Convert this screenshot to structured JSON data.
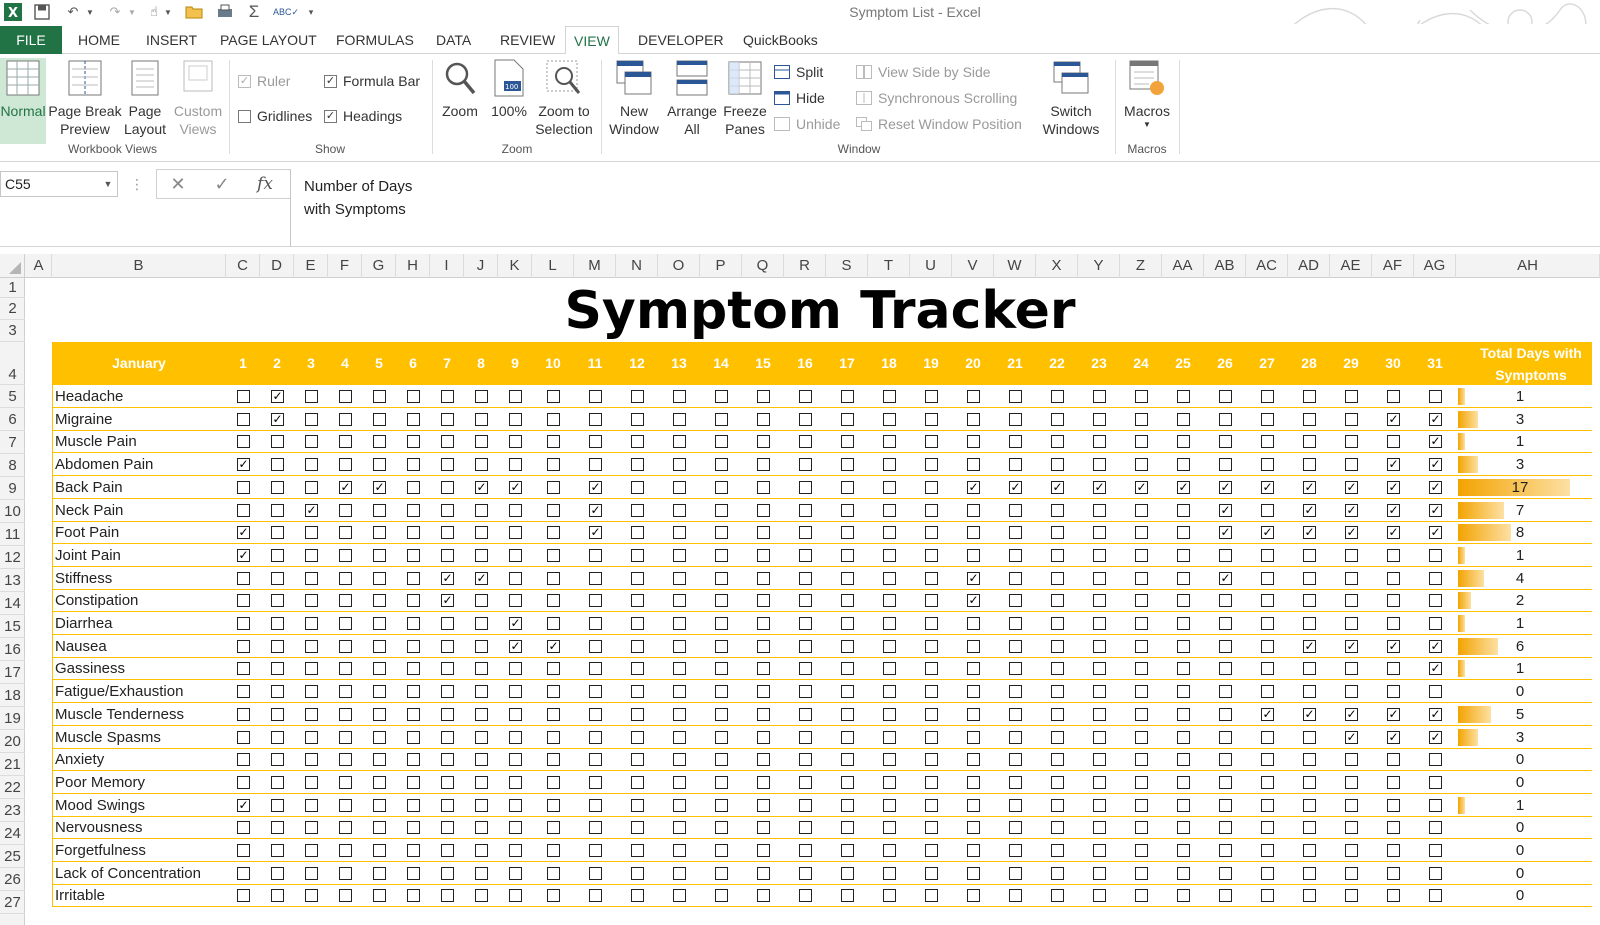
{
  "window": {
    "title": "Symptom List - Excel"
  },
  "tabs": [
    "FILE",
    "HOME",
    "INSERT",
    "PAGE LAYOUT",
    "FORMULAS",
    "DATA",
    "REVIEW",
    "VIEW",
    "DEVELOPER",
    "QuickBooks"
  ],
  "active_tab": "VIEW",
  "ribbon": {
    "workbook_views": {
      "label": "Workbook Views",
      "normal": "Normal",
      "page_break_1": "Page Break",
      "page_break_2": "Preview",
      "page_layout_1": "Page",
      "page_layout_2": "Layout",
      "custom_views_1": "Custom",
      "custom_views_2": "Views"
    },
    "show": {
      "label": "Show",
      "ruler": "Ruler",
      "formula_bar": "Formula Bar",
      "gridlines": "Gridlines",
      "headings": "Headings"
    },
    "zoom": {
      "label": "Zoom",
      "zoom": "Zoom",
      "hundred": "100%",
      "zoom_sel_1": "Zoom to",
      "zoom_sel_2": "Selection"
    },
    "window": {
      "label": "Window",
      "new_window_1": "New",
      "new_window_2": "Window",
      "arrange_1": "Arrange",
      "arrange_2": "All",
      "freeze_1": "Freeze",
      "freeze_2": "Panes",
      "split": "Split",
      "hide": "Hide",
      "unhide": "Unhide",
      "side_by_side": "View Side by Side",
      "sync_scroll": "Synchronous Scrolling",
      "reset_pos": "Reset Window Position",
      "switch_1": "Switch",
      "switch_2": "Windows"
    },
    "macros": {
      "label": "Macros",
      "macros": "Macros"
    }
  },
  "formula_bar": {
    "name_box": "C55",
    "cancel": "✕",
    "enter": "✓",
    "fx": "fx",
    "line1": "Number of Days",
    "line2": "with Symptoms"
  },
  "columns": [
    "A",
    "B",
    "C",
    "D",
    "E",
    "F",
    "G",
    "H",
    "I",
    "J",
    "K",
    "L",
    "M",
    "N",
    "O",
    "P",
    "Q",
    "R",
    "S",
    "T",
    "U",
    "V",
    "W",
    "X",
    "Y",
    "Z",
    "AA",
    "AB",
    "AC",
    "AD",
    "AE",
    "AF",
    "AG",
    "AH"
  ],
  "rows": [
    "1",
    "2",
    "3",
    "4",
    "5",
    "6",
    "7",
    "8",
    "9",
    "10",
    "11",
    "12",
    "13",
    "14",
    "15",
    "16",
    "17",
    "18",
    "19",
    "20",
    "21",
    "22",
    "23",
    "24",
    "25",
    "26",
    "27"
  ],
  "sheet": {
    "title": "Symptom Tracker",
    "month": "January",
    "total_header_1": "Total Days with",
    "total_header_2": "Symptoms",
    "days": [
      "1",
      "2",
      "3",
      "4",
      "5",
      "6",
      "7",
      "8",
      "9",
      "10",
      "11",
      "12",
      "13",
      "14",
      "15",
      "16",
      "17",
      "18",
      "19",
      "20",
      "21",
      "22",
      "23",
      "24",
      "25",
      "26",
      "27",
      "28",
      "29",
      "30",
      "31"
    ],
    "max_total": 17,
    "symptoms": [
      {
        "name": "Headache",
        "checked": [
          2
        ],
        "total": "1"
      },
      {
        "name": "Migraine",
        "checked": [
          2,
          30,
          31
        ],
        "total": "3"
      },
      {
        "name": "Muscle Pain",
        "checked": [
          31
        ],
        "total": "1"
      },
      {
        "name": "Abdomen Pain",
        "checked": [
          1,
          30,
          31
        ],
        "total": "3"
      },
      {
        "name": "Back Pain",
        "checked": [
          4,
          5,
          8,
          9,
          11,
          20,
          21,
          22,
          23,
          24,
          25,
          26,
          27,
          28,
          29,
          30,
          31
        ],
        "total": "17"
      },
      {
        "name": "Neck Pain",
        "checked": [
          3,
          11,
          26,
          28,
          29,
          30,
          31
        ],
        "total": "7"
      },
      {
        "name": "Foot Pain",
        "checked": [
          1,
          11,
          26,
          27,
          28,
          29,
          30,
          31
        ],
        "total": "8"
      },
      {
        "name": "Joint Pain",
        "checked": [
          1
        ],
        "total": "1"
      },
      {
        "name": "Stiffness",
        "checked": [
          7,
          8,
          20,
          26
        ],
        "total": "4"
      },
      {
        "name": "Constipation",
        "checked": [
          7,
          20
        ],
        "total": "2"
      },
      {
        "name": "Diarrhea",
        "checked": [
          9
        ],
        "total": "1"
      },
      {
        "name": "Nausea",
        "checked": [
          9,
          10,
          28,
          29,
          30,
          31
        ],
        "total": "6"
      },
      {
        "name": "Gassiness",
        "checked": [
          31
        ],
        "total": "1"
      },
      {
        "name": "Fatigue/Exhaustion",
        "checked": [],
        "total": "0"
      },
      {
        "name": "Muscle Tenderness",
        "checked": [
          27,
          28,
          29,
          30,
          31
        ],
        "total": "5"
      },
      {
        "name": "Muscle Spasms",
        "checked": [
          29,
          30,
          31
        ],
        "total": "3"
      },
      {
        "name": "Anxiety",
        "checked": [],
        "total": "0"
      },
      {
        "name": "Poor Memory",
        "checked": [],
        "total": "0"
      },
      {
        "name": "Mood Swings",
        "checked": [
          1
        ],
        "total": "1"
      },
      {
        "name": "Nervousness",
        "checked": [],
        "total": "0"
      },
      {
        "name": "Forgetfulness",
        "checked": [],
        "total": "0"
      },
      {
        "name": "Lack of Concentration",
        "checked": [],
        "total": "0"
      },
      {
        "name": "Irritable",
        "checked": [],
        "total": "0"
      }
    ]
  },
  "colors": {
    "excel_green": "#217346",
    "header_gold": "#ffc000",
    "bar_orange": "#f3a300"
  }
}
